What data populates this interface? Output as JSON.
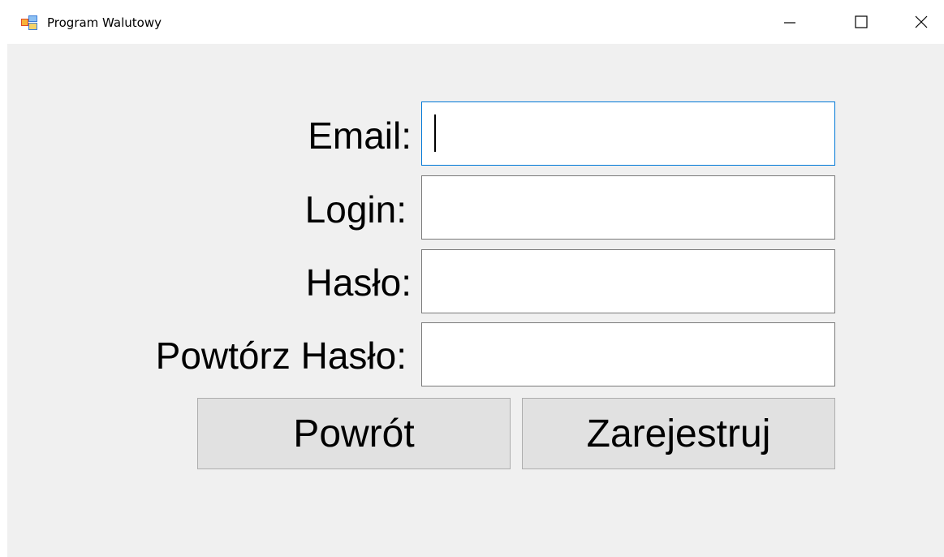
{
  "window": {
    "title": "Program Walutowy",
    "icon": "app-icon",
    "controls": {
      "minimize_icon": "minimize-icon",
      "maximize_icon": "maximize-icon",
      "close_icon": "close-icon"
    }
  },
  "form": {
    "email_label": "Email:",
    "login_label": "Login:",
    "password_label": "Hasło:",
    "repeat_password_label": "Powtórz Hasło:",
    "email_value": "",
    "login_value": "",
    "password_value": "",
    "repeat_password_value": ""
  },
  "buttons": {
    "back_label": "Powrót",
    "register_label": "Zarejestruj"
  },
  "colors": {
    "client_background": "#f0f0f0",
    "focus_border": "#0078d7",
    "button_background": "#e1e1e1"
  }
}
